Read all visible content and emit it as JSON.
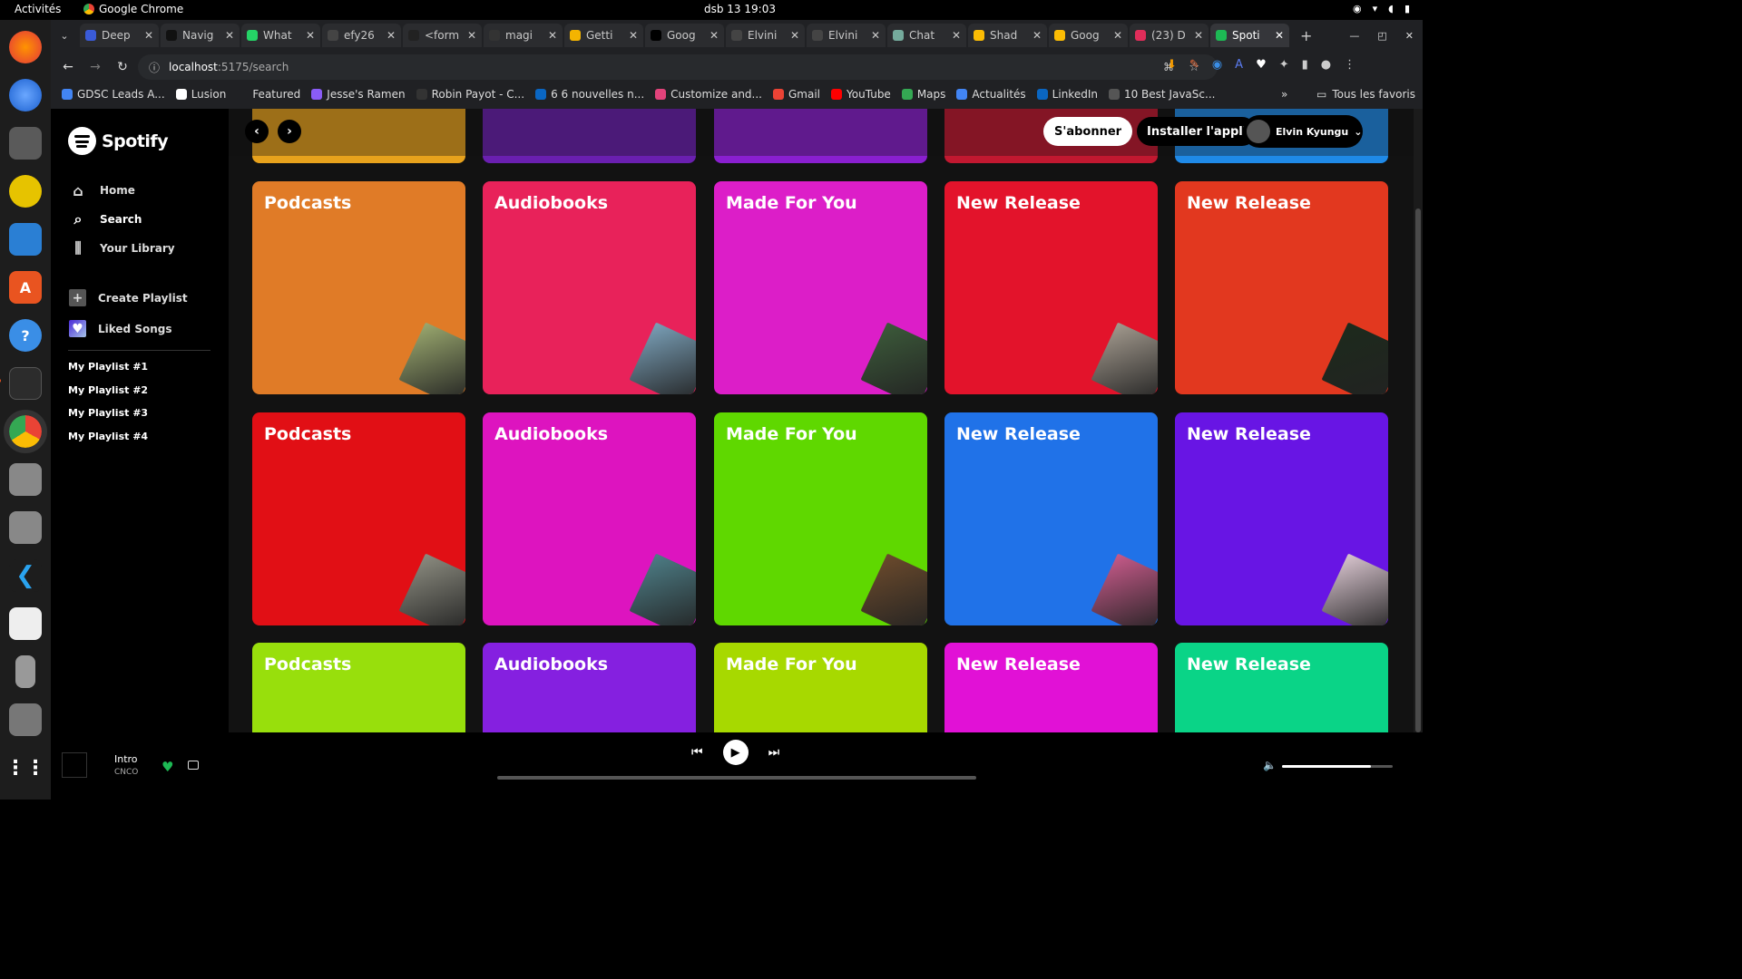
{
  "os_bar": {
    "activities": "Activités",
    "app_name": "Google Chrome",
    "clock": "dsb 13  19:03"
  },
  "tabs": [
    {
      "label": "Deep",
      "color": "#3a5bd9"
    },
    {
      "label": "Navig",
      "color": "#111111"
    },
    {
      "label": "What",
      "color": "#25d366"
    },
    {
      "label": "efy26",
      "color": "#444444"
    },
    {
      "label": "<form",
      "color": "#222222"
    },
    {
      "label": "magi",
      "color": "#333333"
    },
    {
      "label": "Getti",
      "color": "#f4b400"
    },
    {
      "label": "Goog",
      "color": "#000000"
    },
    {
      "label": "Elvini",
      "color": "#444444"
    },
    {
      "label": "Elvini",
      "color": "#444444"
    },
    {
      "label": "Chat",
      "color": "#74aa9c"
    },
    {
      "label": "Shad",
      "color": "#fbbc04"
    },
    {
      "label": "Goog",
      "color": "#fbbc04"
    },
    {
      "label": "(23) D",
      "color": "#e02d5a"
    },
    {
      "label": "Spoti",
      "color": "#1db954"
    }
  ],
  "address": {
    "host": "localhost",
    "path": ":5175/search"
  },
  "bookmarks": [
    {
      "label": "GDSC Leads A...",
      "color": "#4285f4"
    },
    {
      "label": "Lusion",
      "color": "#ffffff"
    },
    {
      "label": "Featured",
      "color": "#202124"
    },
    {
      "label": "Jesse's Ramen",
      "color": "#8a5cf6"
    },
    {
      "label": "Robin Payot - C...",
      "color": "#333333"
    },
    {
      "label": "6 6 nouvelles n...",
      "color": "#0a66c2"
    },
    {
      "label": "Customize and...",
      "color": "#e2437b"
    },
    {
      "label": "Gmail",
      "color": "#ea4335"
    },
    {
      "label": "YouTube",
      "color": "#ff0000"
    },
    {
      "label": "Maps",
      "color": "#34a853"
    },
    {
      "label": "Actualités",
      "color": "#4285f4"
    },
    {
      "label": "LinkedIn",
      "color": "#0a66c2"
    },
    {
      "label": "10 Best JavaSc...",
      "color": "#555555"
    }
  ],
  "all_bookmarks": "Tous les favoris",
  "sidebar": {
    "brand": "Spotify",
    "nav": [
      {
        "label": "Home"
      },
      {
        "label": "Search"
      },
      {
        "label": "Your Library"
      }
    ],
    "create_playlist": "Create Playlist",
    "liked_songs": "Liked Songs",
    "playlists": [
      "My Playlist #1",
      "My Playlist #2",
      "My Playlist #3",
      "My Playlist #4"
    ]
  },
  "header": {
    "subscribe": "S'abonner",
    "install": "Installer l'appli",
    "user": "Elvin Kyungu"
  },
  "grid_rows": [
    [
      {
        "title": "Podcasts",
        "color": "#e07b27",
        "thumb": "#9aa86e"
      },
      {
        "title": "Audiobooks",
        "color": "#e8225a",
        "thumb": "#7aa0b8"
      },
      {
        "title": "Made For You",
        "color": "#dc1ec8",
        "thumb": "#3c5a3a"
      },
      {
        "title": "New Release",
        "color": "#e3132b",
        "thumb": "#a39a8e"
      },
      {
        "title": "New Release",
        "color": "#e2381f",
        "thumb": "#1d2a1c"
      }
    ],
    [
      {
        "title": "Podcasts",
        "color": "#e10f15",
        "thumb": "#8c8c80"
      },
      {
        "title": "Audiobooks",
        "color": "#dd14bf",
        "thumb": "#4d7d86"
      },
      {
        "title": "Made For You",
        "color": "#5fd800",
        "thumb": "#6b4a2c"
      },
      {
        "title": "New Release",
        "color": "#2072e8",
        "thumb": "#c75a8a"
      },
      {
        "title": "New Release",
        "color": "#6815e4",
        "thumb": "#d9c5cf"
      }
    ],
    [
      {
        "title": "Podcasts",
        "color": "#98df0c",
        "thumb": "#777777"
      },
      {
        "title": "Audiobooks",
        "color": "#8520e0",
        "thumb": "#777777"
      },
      {
        "title": "Made For You",
        "color": "#a7d900",
        "thumb": "#777777"
      },
      {
        "title": "New Release",
        "color": "#e111d6",
        "thumb": "#777777"
      },
      {
        "title": "New Release",
        "color": "#0ad487",
        "thumb": "#777777"
      }
    ]
  ],
  "top_row_colors": [
    "#e8a21c",
    "#6a1fb0",
    "#8a1fd0",
    "#c21830",
    "#1f8ae8"
  ],
  "player": {
    "song": "Intro",
    "artist": "CNCO",
    "progress": 0,
    "volume": 0.8
  }
}
